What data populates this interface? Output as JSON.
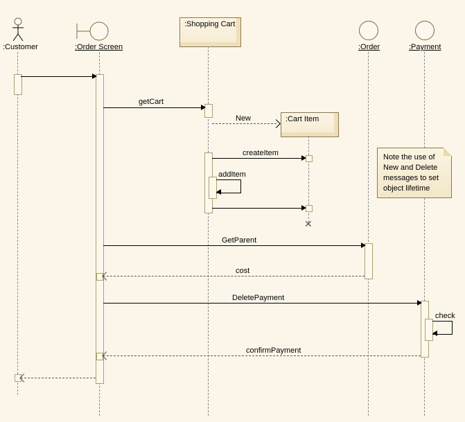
{
  "actor": {
    "label": ":Customer"
  },
  "lifelines": {
    "orderScreen": ":Order Screen",
    "shoppingCart": ":Shopping Cart",
    "cartItem": ":Cart Item",
    "order": ":Order",
    "payment": ":Payment"
  },
  "messages": {
    "getCart": "getCart",
    "new": "New",
    "createItem": "createItem",
    "addItem": "addItem",
    "getParent": "GetParent",
    "cost": "cost",
    "deletePayment": "DeletePayment",
    "check": "check",
    "confirmPayment": "confirmPayment"
  },
  "note": "Note the use of New and Delete messages to set object lifetime"
}
